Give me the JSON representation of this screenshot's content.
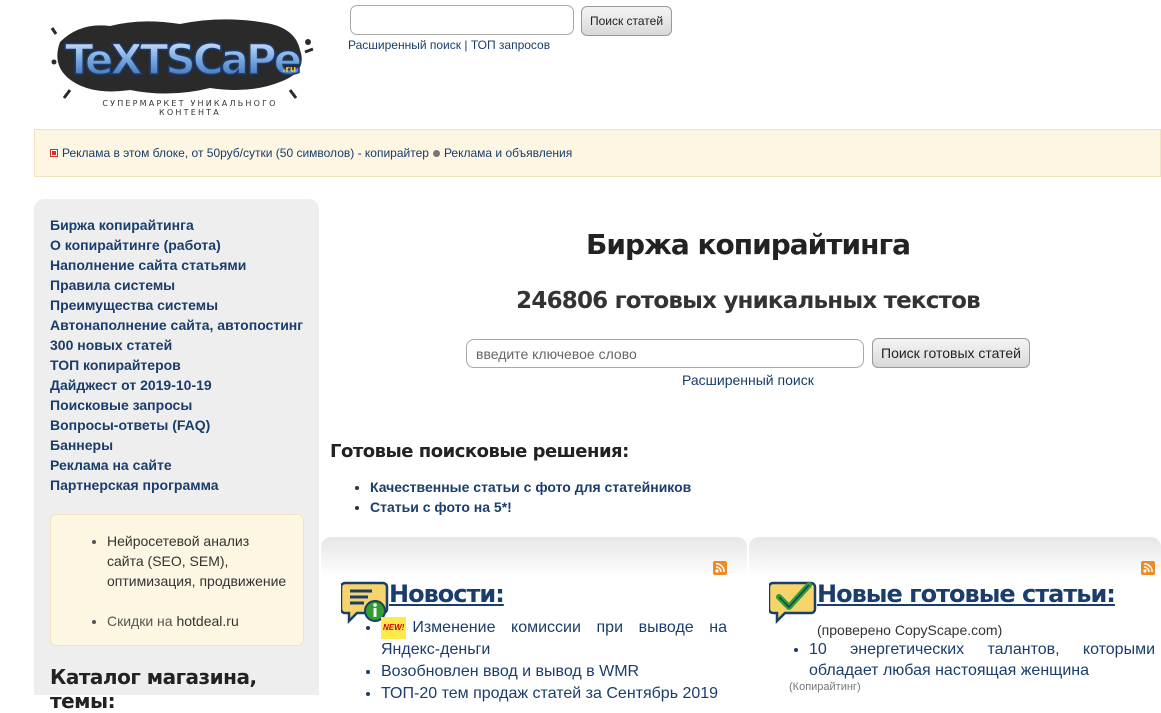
{
  "logo": {
    "text": "TeXTSCaPe",
    "ru": ".ru",
    "tagline": "СУПЕРМАРКЕТ УНИКАЛЬНОГО КОНТЕНТА"
  },
  "top_search": {
    "value": "",
    "button": "Поиск статей",
    "advanced_link": "Расширенный поиск",
    "separator": "|",
    "top_link": "ТОП запросов"
  },
  "ad_bar": {
    "ad_text": "Реклама в этом блоке, от 50руб/сутки (50 символов) - копирайтер",
    "ads_link": "Реклама и объявления"
  },
  "sidebar": {
    "items": [
      {
        "label": "Биржа копирайтинга"
      },
      {
        "label": "О копирайтинге (работа)"
      },
      {
        "label": "Наполнение сайта статьями"
      },
      {
        "label": "Правила системы"
      },
      {
        "label": "Преимущества системы"
      },
      {
        "label": "Автонаполнение сайта, автопостинг"
      },
      {
        "label": "300 новых статей"
      },
      {
        "label": "ТОП копирайтеров"
      },
      {
        "label": "Дайджест от 2019-10-19"
      },
      {
        "label": "Поисковые запросы"
      },
      {
        "label": "Вопросы-ответы (FAQ)"
      },
      {
        "label": "Баннеры"
      },
      {
        "label": "Реклама на сайте"
      },
      {
        "label": "Партнерская программа"
      }
    ],
    "promo": {
      "item1": "Нейросетевой анализ сайта (SEO, SEM), оптимизация, продвижение",
      "item2_prefix": "Скидки на ",
      "item2_link": "hotdeal.ru"
    },
    "catalog_title": "Каталог магазина, темы:"
  },
  "main": {
    "title": "Биржа копирайтинга",
    "subtitle": "246806 готовых уникальных текстов",
    "search_placeholder": "введите ключевое слово",
    "search_button": "Поиск готовых статей",
    "advanced_link": "Расширенный поиск",
    "solutions_title": "Готовые поисковые решения:",
    "solutions": [
      {
        "label": "Качественные статьи с фото для статейников"
      },
      {
        "label": "Статьи с фото на 5*!"
      }
    ]
  },
  "news_panel": {
    "title": "Новости:",
    "new_badge": "NEW!",
    "items": [
      {
        "text": "Изменение комиссии при выводе на Яндекс-деньги"
      },
      {
        "text": "Возобновлен ввод и вывод в WMR"
      },
      {
        "text": "ТОП-20 тем продаж статей за Сентябрь 2019"
      }
    ]
  },
  "articles_panel": {
    "title": "Новые готовые статьи:",
    "checked_note": "(проверено CopyScape.com)",
    "items": [
      {
        "text": "10 энергетических талантов, которыми обладает любая настоящая женщина",
        "tag": "(Копирайтинг)"
      }
    ]
  },
  "colors": {
    "link": "#1a3d6b",
    "ad_background": "#fcf6e2",
    "sidebar_background": "#eeeeee",
    "rss": "#f08a24"
  }
}
